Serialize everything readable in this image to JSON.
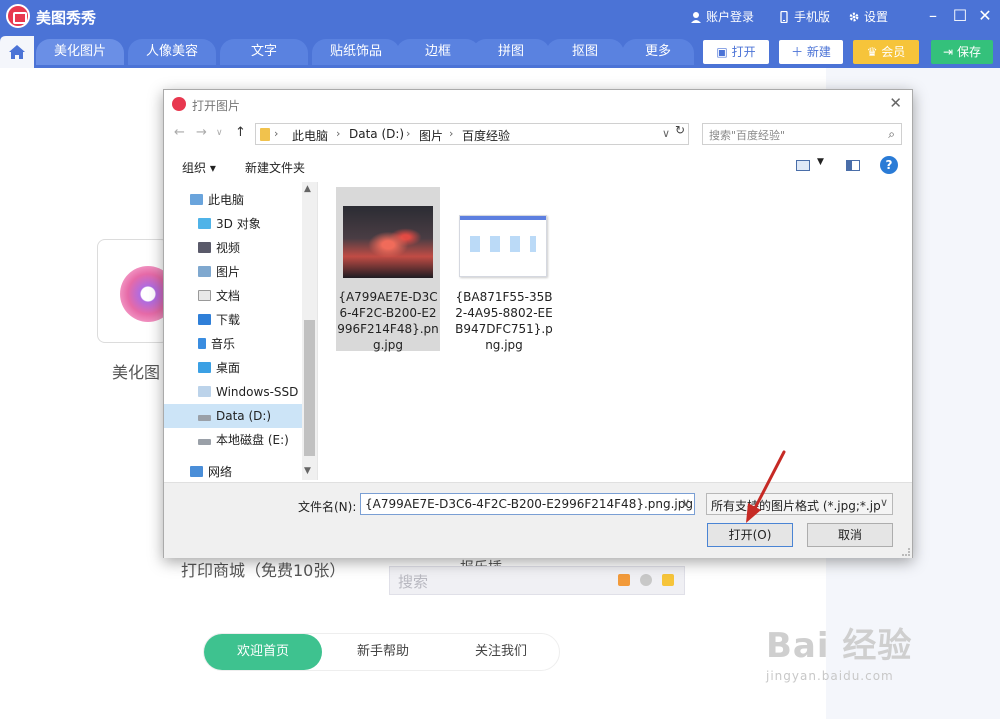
{
  "app": {
    "title": "美图秀秀",
    "account": "账户登录",
    "mobile": "手机版",
    "settings": "设置"
  },
  "nav": {
    "tabs": [
      "美化图片",
      "人像美容",
      "文字",
      "贴纸饰品",
      "边框",
      "拼图",
      "抠图",
      "更多"
    ],
    "open": "打开",
    "new": "新建",
    "vip": "会员",
    "save": "保存"
  },
  "main": {
    "beautify_label": "美化图",
    "print_label": "打印商城（免费10张）",
    "partial_label": "报乐插",
    "search_placeholder": "搜索",
    "bottom_tabs": [
      "欢迎首页",
      "新手帮助",
      "关注我们"
    ]
  },
  "dialog": {
    "title": "打开图片",
    "breadcrumb": [
      "此电脑",
      "Data (D:)",
      "图片",
      "百度经验"
    ],
    "search_placeholder": "搜索\"百度经验\"",
    "organize": "组织 ▾",
    "new_folder": "新建文件夹",
    "tree": [
      {
        "label": "此电脑",
        "icon": "computer-icon"
      },
      {
        "label": "3D 对象",
        "icon": "3d-objects-icon"
      },
      {
        "label": "视频",
        "icon": "video-icon"
      },
      {
        "label": "图片",
        "icon": "pictures-icon"
      },
      {
        "label": "文档",
        "icon": "documents-icon"
      },
      {
        "label": "下载",
        "icon": "download-icon"
      },
      {
        "label": "音乐",
        "icon": "music-icon"
      },
      {
        "label": "桌面",
        "icon": "desktop-icon"
      },
      {
        "label": "Windows-SSD (C",
        "icon": "drive-icon"
      },
      {
        "label": "Data (D:)",
        "icon": "drive-icon",
        "selected": true
      },
      {
        "label": "本地磁盘 (E:)",
        "icon": "drive-icon"
      },
      {
        "label": "网络",
        "icon": "network-icon"
      }
    ],
    "files": [
      {
        "name": "{A799AE7E-D3C6-4F2C-B200-E2996F214F48}.png.jpg",
        "selected": true
      },
      {
        "name": "{BA871F55-35B2-4A95-8802-EEB947DFC751}.png.jpg",
        "selected": false
      }
    ],
    "filename_label": "文件名(N):",
    "filename_value": "{A799AE7E-D3C6-4F2C-B200-E2996F214F48}.png.jpg",
    "filetype_value": "所有支持的图片格式 (*.jpg;*.jp",
    "open_button": "打开(O)",
    "cancel_button": "取消"
  },
  "watermark": {
    "main": "Bai 经验",
    "sub": "jingyan.baidu.com"
  },
  "colors": {
    "brand_blue": "#4b73d6",
    "vip_yellow": "#f6c43a",
    "save_green": "#34c17b",
    "active_tab_green": "#3ec28f",
    "annotation_red": "#c62a25"
  }
}
